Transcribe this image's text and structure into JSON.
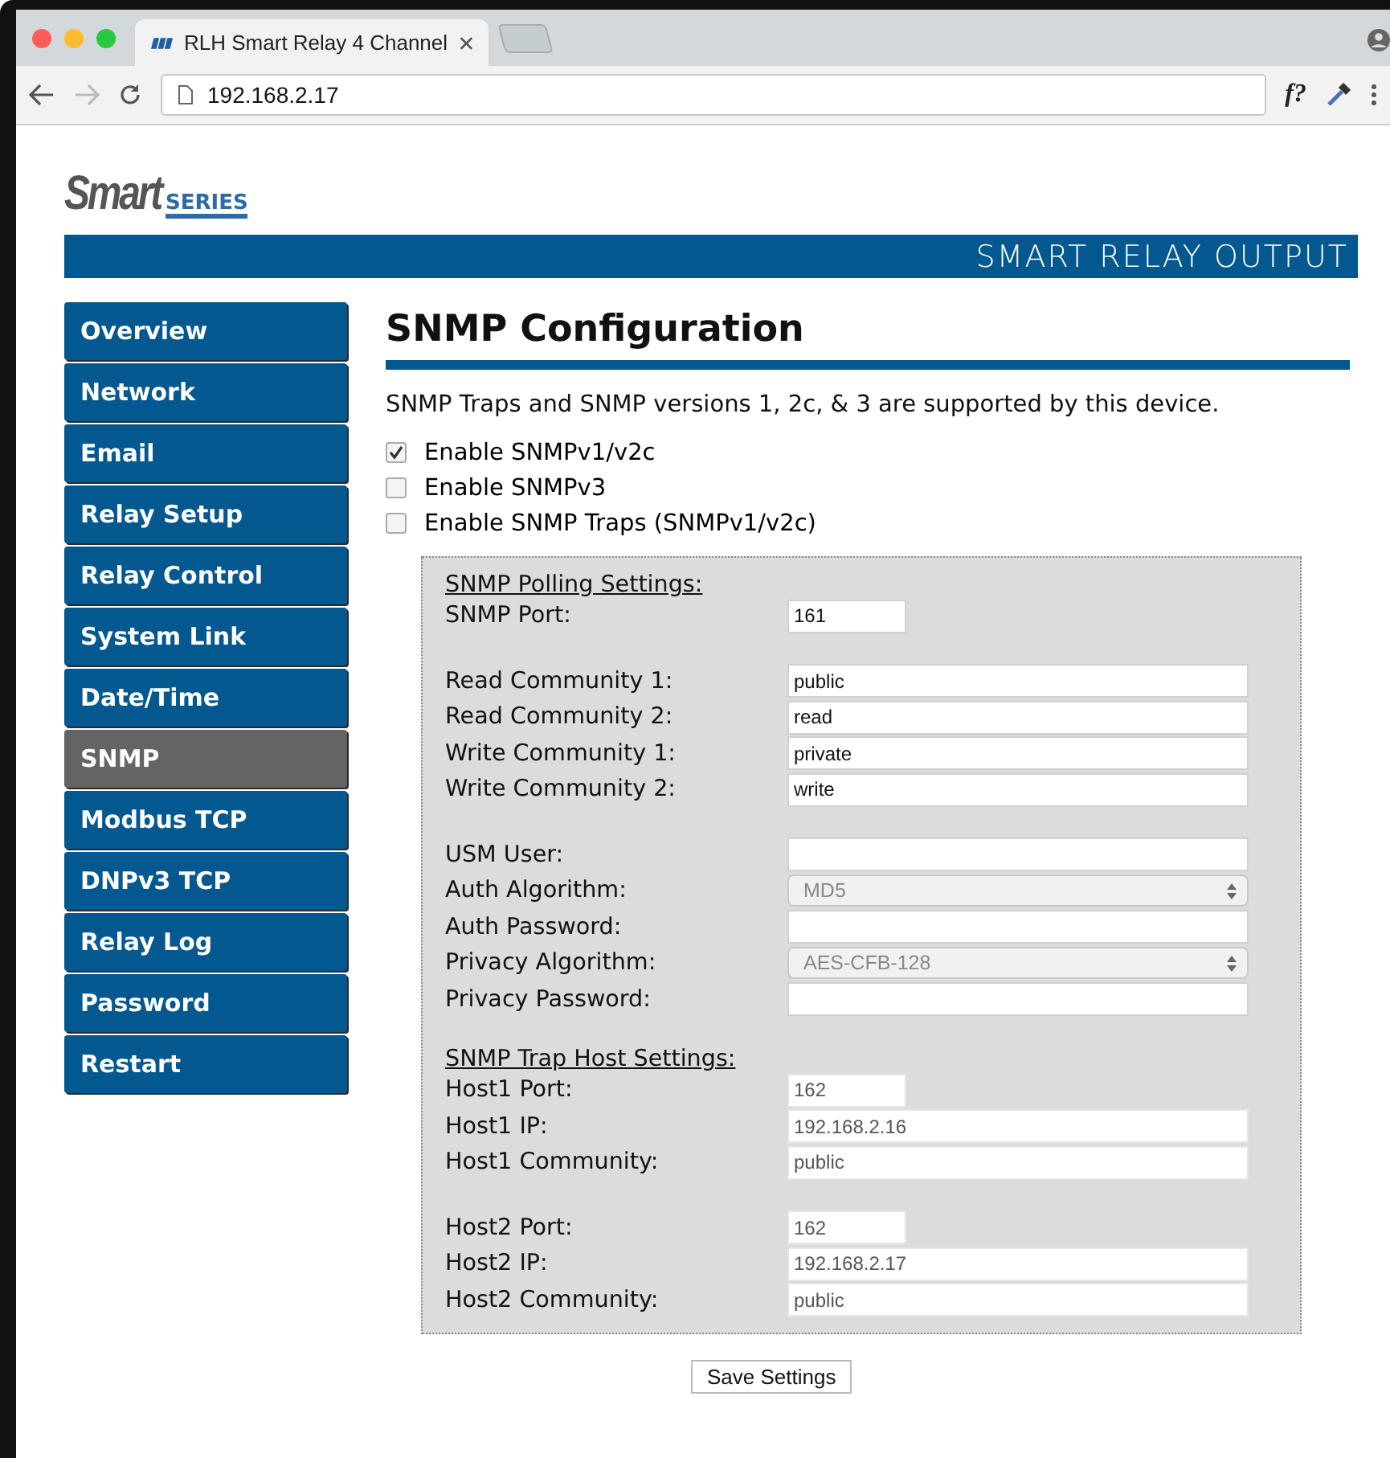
{
  "browser": {
    "tab_title": "RLH Smart Relay 4 Channel",
    "address": "192.168.2.17",
    "toolbar_text": "f?"
  },
  "header": {
    "logo_main": "Smart",
    "logo_sub": "SERIES",
    "banner": "SMART RELAY OUTPUT"
  },
  "sidebar": {
    "items": [
      {
        "label": "Overview",
        "selected": false
      },
      {
        "label": "Network",
        "selected": false
      },
      {
        "label": "Email",
        "selected": false
      },
      {
        "label": "Relay Setup",
        "selected": false
      },
      {
        "label": "Relay Control",
        "selected": false
      },
      {
        "label": "System Link",
        "selected": false
      },
      {
        "label": "Date/Time",
        "selected": false
      },
      {
        "label": "SNMP",
        "selected": true
      },
      {
        "label": "Modbus TCP",
        "selected": false
      },
      {
        "label": "DNPv3 TCP",
        "selected": false
      },
      {
        "label": "Relay Log",
        "selected": false
      },
      {
        "label": "Password",
        "selected": false
      },
      {
        "label": "Restart",
        "selected": false
      }
    ]
  },
  "title": "SNMP Configuration",
  "intro": "SNMP Traps and SNMP versions 1, 2c, & 3 are supported by this device.",
  "options": [
    {
      "label": "Enable SNMPv1/v2c",
      "checked": true
    },
    {
      "label": "Enable SNMPv3",
      "checked": false
    },
    {
      "label": "Enable SNMP Traps (SNMPv1/v2c)",
      "checked": false
    }
  ],
  "settings": {
    "sections": [
      {
        "heading": "SNMP Polling Settings:",
        "groups": [
          [
            {
              "label": "SNMP Port:",
              "kind": "port",
              "value": "161",
              "disabled": false
            }
          ],
          [
            {
              "label": "Read Community 1:",
              "kind": "text",
              "value": "public",
              "disabled": false
            },
            {
              "label": "Read Community 2:",
              "kind": "text",
              "value": "read",
              "disabled": false
            },
            {
              "label": "Write Community 1:",
              "kind": "text",
              "value": "private",
              "disabled": false
            },
            {
              "label": "Write Community 2:",
              "kind": "text",
              "value": "write",
              "disabled": false
            }
          ],
          [
            {
              "label": "USM User:",
              "kind": "text",
              "disabled": false
            },
            {
              "label": "Auth Algorithm:",
              "kind": "select",
              "value": "MD5",
              "disabled": true
            },
            {
              "label": "Auth Password:",
              "kind": "text",
              "disabled": false
            },
            {
              "label": "Privacy Algorithm:",
              "kind": "select",
              "value": "AES-CFB-128",
              "disabled": true
            },
            {
              "label": "Privacy Password:",
              "kind": "text",
              "disabled": false
            }
          ]
        ]
      },
      {
        "heading": "SNMP Trap Host Settings:",
        "groups": [
          [
            {
              "label": "Host1 Port:",
              "kind": "port",
              "value": "162",
              "disabled": true
            },
            {
              "label": "Host1 IP:",
              "kind": "text",
              "value": "192.168.2.16",
              "disabled": true
            },
            {
              "label": "Host1 Community:",
              "kind": "text",
              "value": "public",
              "disabled": true
            }
          ],
          [
            {
              "label": "Host2 Port:",
              "kind": "port",
              "value": "162",
              "disabled": true
            },
            {
              "label": "Host2 IP:",
              "kind": "text",
              "value": "192.168.2.17",
              "disabled": true
            },
            {
              "label": "Host2 Community:",
              "kind": "text",
              "value": "public",
              "disabled": true
            }
          ]
        ]
      }
    ]
  },
  "save_button": "Save Settings"
}
